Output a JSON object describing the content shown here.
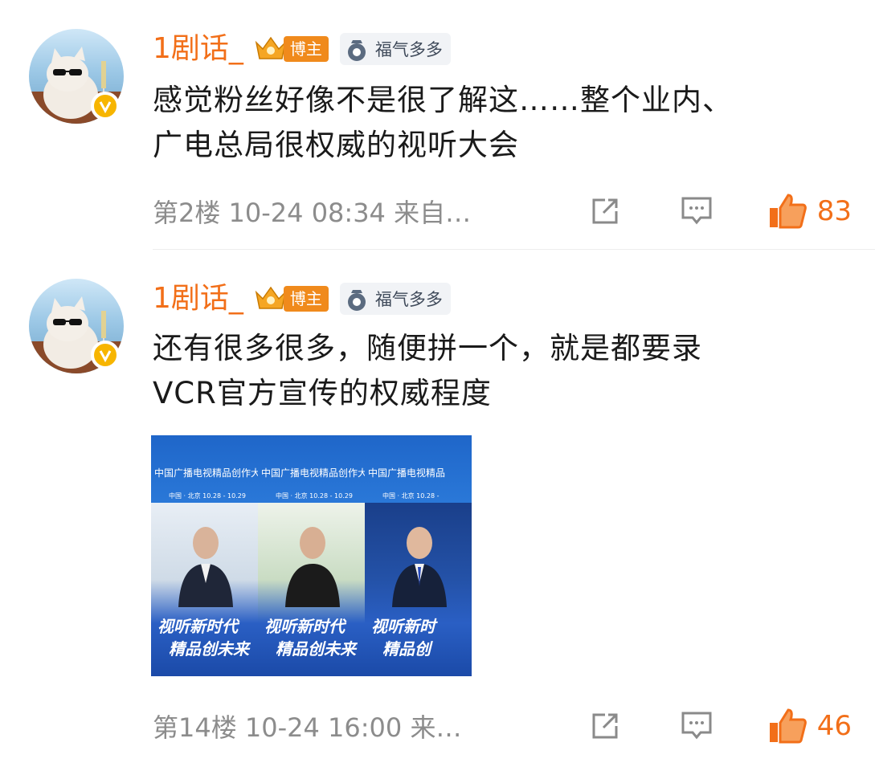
{
  "comments": [
    {
      "username": "1剧话_",
      "badge_blogger": "博主",
      "badge_fuqi": "福气多多",
      "text": "感觉粉丝好像不是很了解这……整个业内、\n广电总局很权威的视听大会",
      "meta": "第2楼 10-24 08:34 来自…",
      "likes": "83"
    },
    {
      "username": "1剧话_",
      "badge_blogger": "博主",
      "badge_fuqi": "福气多多",
      "text": "还有很多很多，随便拼一个，就是都要录\nVCR官方宣传的权威程度",
      "meta": "第14楼 10-24 16:00 来…",
      "likes": "46"
    }
  ],
  "image_thumbs": [
    {
      "title": "中国广播电视精品创作大",
      "date": "中国 · 北京   10.28 - 10.29",
      "slogan1": "视听新时代",
      "slogan2": "精品创未来"
    },
    {
      "title": "中国广播电视精品创作大",
      "date": "中国 · 北京   10.28 - 10.29",
      "slogan1": "视听新时代",
      "slogan2": "精品创未来"
    },
    {
      "title": "中国广播电视精品",
      "date": "中国 · 北京   10.28 -",
      "slogan1": "视听新时",
      "slogan2": "精品创"
    }
  ],
  "colors": {
    "accent": "#f26f19",
    "meta": "#8c8c8c",
    "text": "#1a1a1a"
  },
  "icons": {
    "share": "share-icon",
    "comment": "comment-icon",
    "like": "thumbs-up-icon",
    "verified": "verified-v-icon"
  }
}
